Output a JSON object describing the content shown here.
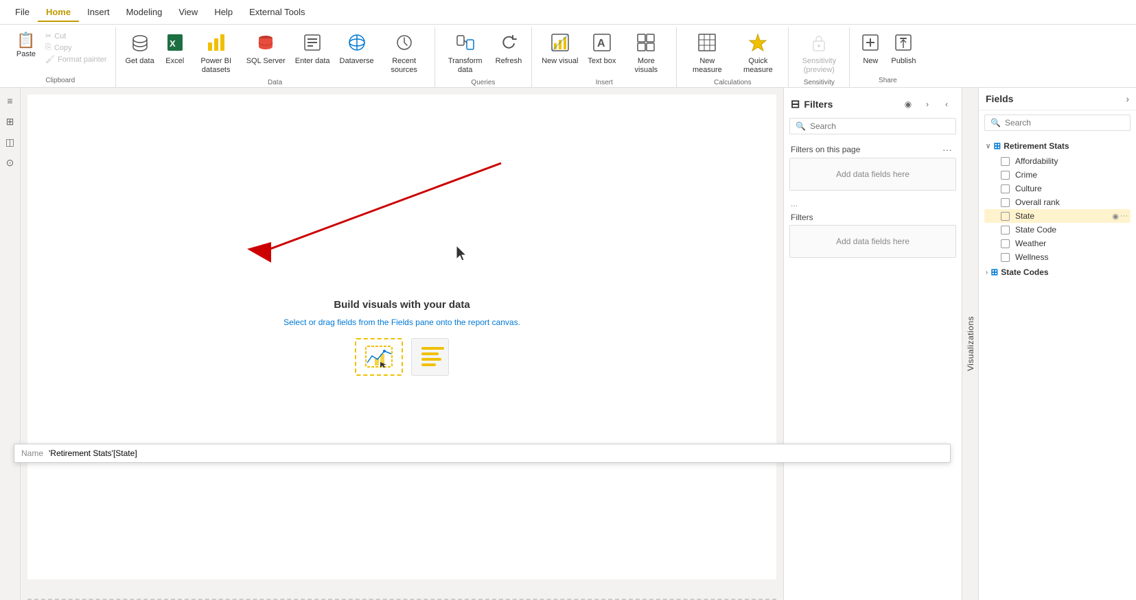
{
  "menu": {
    "items": [
      {
        "id": "file",
        "label": "File",
        "active": false
      },
      {
        "id": "home",
        "label": "Home",
        "active": true
      },
      {
        "id": "insert",
        "label": "Insert",
        "active": false
      },
      {
        "id": "modeling",
        "label": "Modeling",
        "active": false
      },
      {
        "id": "view",
        "label": "View",
        "active": false
      },
      {
        "id": "help",
        "label": "Help",
        "active": false
      },
      {
        "id": "external-tools",
        "label": "External Tools",
        "active": false
      }
    ]
  },
  "ribbon": {
    "groups": [
      {
        "id": "clipboard",
        "label": "Clipboard",
        "buttons": [
          {
            "id": "paste",
            "label": "Paste",
            "icon": "📋",
            "disabled": false
          },
          {
            "id": "cut",
            "label": "Cut",
            "icon": "✂️",
            "disabled": true,
            "small": true
          },
          {
            "id": "copy",
            "label": "Copy",
            "icon": "📄",
            "disabled": true,
            "small": true
          },
          {
            "id": "format-painter",
            "label": "Format painter",
            "icon": "🖌️",
            "disabled": true,
            "small": true
          }
        ]
      },
      {
        "id": "data",
        "label": "Data",
        "buttons": [
          {
            "id": "get-data",
            "label": "Get data",
            "icon": "🗄️",
            "hasDropdown": true
          },
          {
            "id": "excel",
            "label": "Excel",
            "icon": "📗"
          },
          {
            "id": "power-bi-datasets",
            "label": "Power BI datasets",
            "icon": "📊"
          },
          {
            "id": "sql-server",
            "label": "SQL Server",
            "icon": "🗃️"
          },
          {
            "id": "enter-data",
            "label": "Enter data",
            "icon": "📝"
          },
          {
            "id": "dataverse",
            "label": "Dataverse",
            "icon": "🔷"
          },
          {
            "id": "recent-sources",
            "label": "Recent sources",
            "icon": "🕐",
            "hasDropdown": true
          }
        ]
      },
      {
        "id": "queries",
        "label": "Queries",
        "buttons": [
          {
            "id": "transform-data",
            "label": "Transform data",
            "icon": "🔄",
            "hasDropdown": true
          },
          {
            "id": "refresh",
            "label": "Refresh",
            "icon": "↻"
          }
        ]
      },
      {
        "id": "insert",
        "label": "Insert",
        "buttons": [
          {
            "id": "new-visual",
            "label": "New visual",
            "icon": "📊"
          },
          {
            "id": "text-box",
            "label": "Text box",
            "icon": "🅐"
          },
          {
            "id": "more-visuals",
            "label": "More visuals",
            "icon": "📉",
            "hasDropdown": true
          }
        ]
      },
      {
        "id": "calculations",
        "label": "Calculations",
        "buttons": [
          {
            "id": "new-measure",
            "label": "New measure",
            "icon": "🔢"
          },
          {
            "id": "quick-measure",
            "label": "Quick measure",
            "icon": "⚡"
          }
        ]
      },
      {
        "id": "sensitivity",
        "label": "Sensitivity",
        "buttons": [
          {
            "id": "sensitivity-preview",
            "label": "Sensitivity (preview)",
            "icon": "🔒",
            "hasDropdown": true,
            "disabled": true
          }
        ]
      },
      {
        "id": "share",
        "label": "Share",
        "buttons": [
          {
            "id": "new-btn",
            "label": "New",
            "icon": "🔔"
          },
          {
            "id": "publish",
            "label": "Publish",
            "icon": "📤"
          }
        ]
      }
    ]
  },
  "canvas": {
    "build_title": "Build visuals with your data",
    "build_subtitle_prefix": "Select or drag fields from the ",
    "build_subtitle_link": "Fields",
    "build_subtitle_suffix": " pane onto the report canvas."
  },
  "filters": {
    "title": "Filters",
    "search_placeholder": "Search",
    "on_this_page": "Filters on this page",
    "add_data_fields": "Add data fields here",
    "filters_label": "Filters",
    "filter_dots": "..."
  },
  "visualizations_tab": {
    "label": "Visualizations"
  },
  "fields": {
    "title": "Fields",
    "search_placeholder": "Search",
    "groups": [
      {
        "id": "retirement-stats",
        "label": "Retirement Stats",
        "expanded": true,
        "items": [
          {
            "id": "affordability",
            "label": "Affordability",
            "checked": false
          },
          {
            "id": "crime",
            "label": "Crime",
            "checked": false
          },
          {
            "id": "culture",
            "label": "Culture",
            "checked": false
          },
          {
            "id": "overall-rank",
            "label": "Overall rank",
            "checked": false
          },
          {
            "id": "state",
            "label": "State",
            "checked": false,
            "highlighted": true,
            "has_eye": true,
            "has_dots": true
          },
          {
            "id": "state-code",
            "label": "State Code",
            "checked": false
          },
          {
            "id": "weather",
            "label": "Weather",
            "checked": false
          },
          {
            "id": "wellness",
            "label": "Wellness",
            "checked": false
          }
        ]
      },
      {
        "id": "state-codes",
        "label": "State Codes",
        "expanded": false,
        "items": []
      }
    ]
  },
  "tooltip": {
    "name_label": "Name",
    "name_value": "'Retirement Stats'[State]"
  },
  "icons": {
    "funnel": "⊟",
    "eye": "◉",
    "chevron_right": "›",
    "chevron_left": "‹",
    "chevron_down": "∨",
    "search": "🔍",
    "expand": "›",
    "collapse": "∨",
    "table": "⊞",
    "checkbox_empty": "",
    "checkbox_checked": "✓"
  }
}
